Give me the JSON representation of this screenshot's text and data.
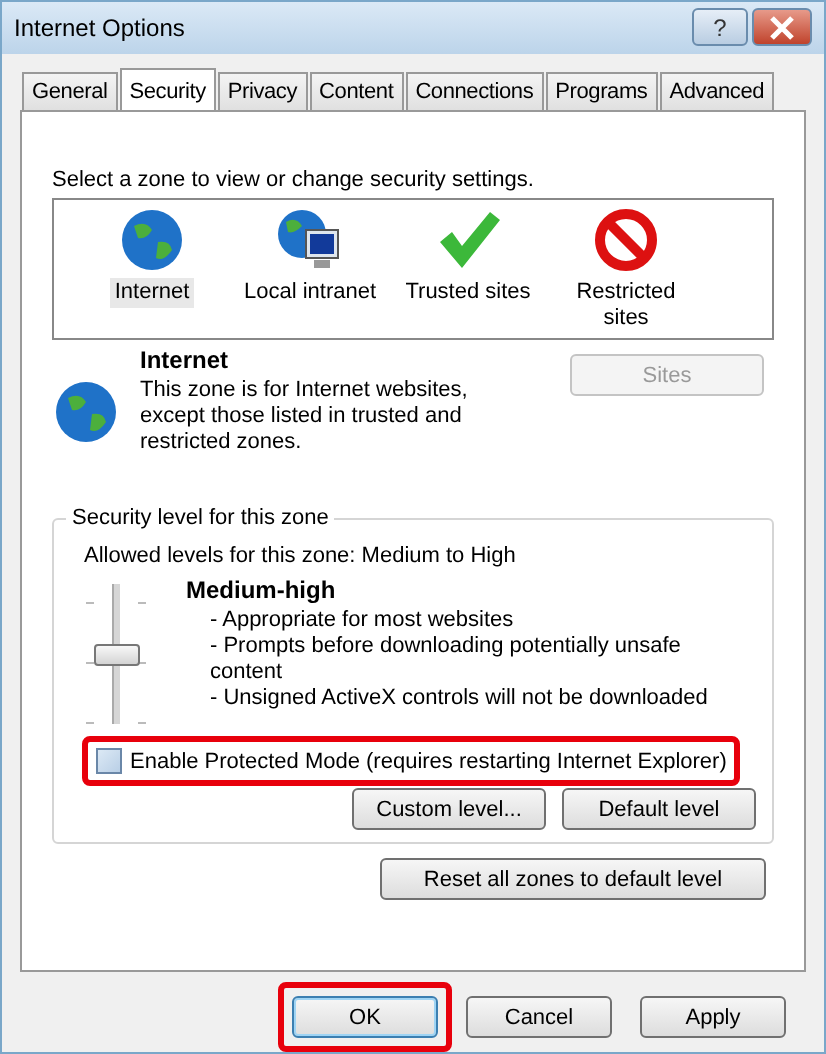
{
  "window": {
    "title": "Internet Options",
    "help_label": "?"
  },
  "tabs": [
    {
      "label": "General",
      "selected": false
    },
    {
      "label": "Security",
      "selected": true
    },
    {
      "label": "Privacy",
      "selected": false
    },
    {
      "label": "Content",
      "selected": false
    },
    {
      "label": "Connections",
      "selected": false
    },
    {
      "label": "Programs",
      "selected": false
    },
    {
      "label": "Advanced",
      "selected": false
    }
  ],
  "zone_prompt": "Select a zone to view or change security settings.",
  "zones": [
    {
      "kind": "globe",
      "label": "Internet",
      "selected": true
    },
    {
      "kind": "intranet",
      "label": "Local intranet",
      "selected": false
    },
    {
      "kind": "check",
      "label": "Trusted sites",
      "selected": false
    },
    {
      "kind": "blocked",
      "label": "Restricted sites",
      "selected": false
    }
  ],
  "zone_info": {
    "kind": "globe",
    "title": "Internet",
    "description": "This zone is for Internet websites, except those listed in trusted and restricted zones.",
    "sites_button": {
      "label": "Sites",
      "disabled": true
    }
  },
  "security_level": {
    "legend": "Security level for this zone",
    "allowed": "Allowed levels for this zone: Medium to High",
    "level": 0.5,
    "name": "Medium-high",
    "points": [
      "- Appropriate for most websites",
      "- Prompts before downloading potentially unsafe content",
      "- Unsigned ActiveX controls will not be downloaded"
    ],
    "protected_mode": {
      "label": "Enable Protected Mode (requires restarting Internet Explorer)",
      "checked": false,
      "highlighted": true
    },
    "buttons": [
      {
        "label": "Custom level..."
      },
      {
        "label": "Default level"
      }
    ]
  },
  "reset_button": {
    "label": "Reset all zones to default level"
  },
  "dialog_buttons": [
    {
      "label": "OK",
      "default": true,
      "highlighted": true
    },
    {
      "label": "Cancel",
      "default": false,
      "highlighted": false
    },
    {
      "label": "Apply",
      "default": false,
      "highlighted": false
    }
  ]
}
